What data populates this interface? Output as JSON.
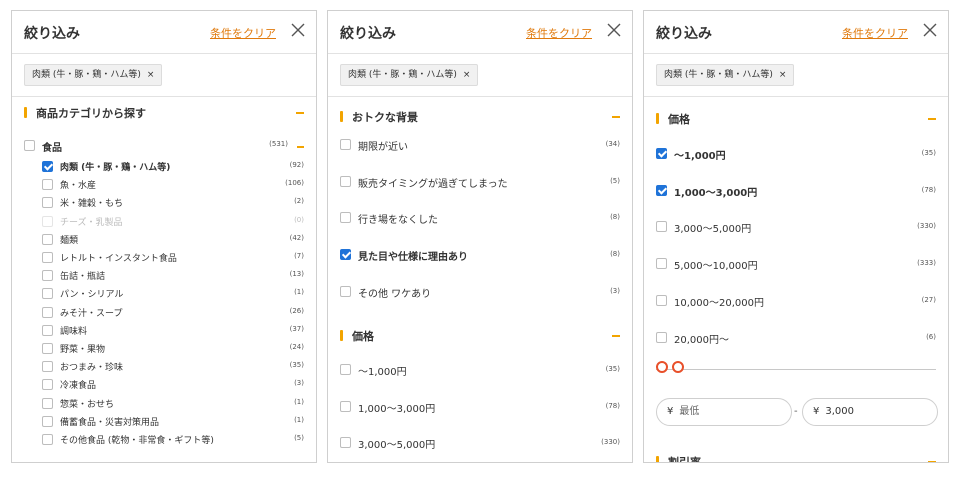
{
  "title": "絞り込み",
  "clear_label": "条件をクリア",
  "chip_label": "肉類 (牛・豚・鶏・ハム等)",
  "chip_x": "×",
  "panel1": {
    "section_title": "商品カテゴリから探す",
    "parent": {
      "label": "食品",
      "count": "(531)"
    },
    "items": [
      {
        "label": "肉類 (牛・豚・鶏・ハム等)",
        "count": "(92)",
        "checked": true,
        "disabled": false
      },
      {
        "label": "魚・水産",
        "count": "(106)",
        "checked": false,
        "disabled": false
      },
      {
        "label": "米・雑穀・もち",
        "count": "(2)",
        "checked": false,
        "disabled": false
      },
      {
        "label": "チーズ・乳製品",
        "count": "(0)",
        "checked": false,
        "disabled": true
      },
      {
        "label": "麺類",
        "count": "(42)",
        "checked": false,
        "disabled": false
      },
      {
        "label": "レトルト・インスタント食品",
        "count": "(7)",
        "checked": false,
        "disabled": false
      },
      {
        "label": "缶詰・瓶詰",
        "count": "(13)",
        "checked": false,
        "disabled": false
      },
      {
        "label": "パン・シリアル",
        "count": "(1)",
        "checked": false,
        "disabled": false
      },
      {
        "label": "みそ汁・スープ",
        "count": "(26)",
        "checked": false,
        "disabled": false
      },
      {
        "label": "調味料",
        "count": "(37)",
        "checked": false,
        "disabled": false
      },
      {
        "label": "野菜・果物",
        "count": "(24)",
        "checked": false,
        "disabled": false
      },
      {
        "label": "おつまみ・珍味",
        "count": "(35)",
        "checked": false,
        "disabled": false
      },
      {
        "label": "冷凍食品",
        "count": "(3)",
        "checked": false,
        "disabled": false
      },
      {
        "label": "惣菜・おせち",
        "count": "(1)",
        "checked": false,
        "disabled": false
      },
      {
        "label": "備蓄食品・災害対策用品",
        "count": "(1)",
        "checked": false,
        "disabled": false
      },
      {
        "label": "その他食品 (乾物・非常食・ギフト等)",
        "count": "(5)",
        "checked": false,
        "disabled": false
      }
    ]
  },
  "panel2": {
    "section1_title": "おトクな背景",
    "items1": [
      {
        "label": "期限が近い",
        "count": "(34)",
        "checked": false
      },
      {
        "label": "販売タイミングが過ぎてしまった",
        "count": "(5)",
        "checked": false
      },
      {
        "label": "行き場をなくした",
        "count": "(8)",
        "checked": false
      },
      {
        "label": "見た目や仕様に理由あり",
        "count": "(8)",
        "checked": true
      },
      {
        "label": "その他 ワケあり",
        "count": "(3)",
        "checked": false
      }
    ],
    "section2_title": "価格",
    "items2": [
      {
        "label": "〜1,000円",
        "count": "(35)",
        "checked": false
      },
      {
        "label": "1,000〜3,000円",
        "count": "(78)",
        "checked": false
      },
      {
        "label": "3,000〜5,000円",
        "count": "(330)",
        "checked": false
      }
    ]
  },
  "panel3": {
    "section1_title": "価格",
    "items": [
      {
        "label": "〜1,000円",
        "count": "(35)",
        "checked": true
      },
      {
        "label": "1,000〜3,000円",
        "count": "(78)",
        "checked": true
      },
      {
        "label": "3,000〜5,000円",
        "count": "(330)",
        "checked": false
      },
      {
        "label": "5,000〜10,000円",
        "count": "(333)",
        "checked": false
      },
      {
        "label": "10,000〜20,000円",
        "count": "(27)",
        "checked": false
      },
      {
        "label": "20,000円〜",
        "count": "(6)",
        "checked": false
      }
    ],
    "yen": "¥",
    "min_placeholder": "最低",
    "max_value": "3,000",
    "range_dash": "-",
    "section2_title": "割引率"
  },
  "colors": {
    "accent": "#f2a400",
    "link": "#e07a0c",
    "check": "#1f73d8",
    "slider": "#e8502a"
  }
}
